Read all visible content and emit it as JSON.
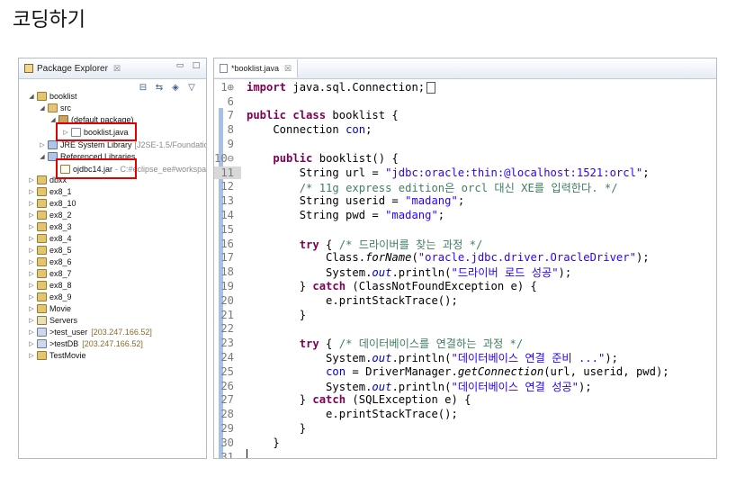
{
  "slide": {
    "title": "코딩하기"
  },
  "package_explorer": {
    "tab_label": "Package Explorer",
    "tab_close": "☒",
    "tree": [
      {
        "label": "booklist",
        "suffix": "",
        "icon": "project-icon",
        "twisty": "◢"
      },
      {
        "label": "src",
        "suffix": "",
        "icon": "source-folder-icon",
        "twisty": "◢"
      },
      {
        "label": "(default package)",
        "suffix": "",
        "icon": "package-icon",
        "twisty": "◢"
      },
      {
        "label": "booklist.java",
        "suffix": "",
        "icon": "java-file-icon",
        "twisty": "▷"
      },
      {
        "label": "JRE System Library",
        "suffix": "[J2SE-1.5/Foundation",
        "icon": "library-icon",
        "twisty": "▷"
      },
      {
        "label": "Referenced Libraries",
        "suffix": "",
        "icon": "library-icon",
        "twisty": "◢"
      },
      {
        "label": "ojdbc14.jar",
        "suffix": "- C:#eclipse_ee#workspa",
        "icon": "jar-icon",
        "twisty": ""
      },
      {
        "label": "dbxx",
        "suffix": "",
        "icon": "project-icon",
        "twisty": "▷"
      },
      {
        "label": "ex8_1",
        "suffix": "",
        "icon": "project-icon",
        "twisty": "▷"
      },
      {
        "label": "ex8_10",
        "suffix": "",
        "icon": "project-icon",
        "twisty": "▷"
      },
      {
        "label": "ex8_2",
        "suffix": "",
        "icon": "project-icon",
        "twisty": "▷"
      },
      {
        "label": "ex8_3",
        "suffix": "",
        "icon": "project-icon",
        "twisty": "▷"
      },
      {
        "label": "ex8_4",
        "suffix": "",
        "icon": "project-icon",
        "twisty": "▷"
      },
      {
        "label": "ex8_5",
        "suffix": "",
        "icon": "project-icon",
        "twisty": "▷"
      },
      {
        "label": "ex8_6",
        "suffix": "",
        "icon": "project-icon",
        "twisty": "▷"
      },
      {
        "label": "ex8_7",
        "suffix": "",
        "icon": "project-icon",
        "twisty": "▷"
      },
      {
        "label": "ex8_8",
        "suffix": "",
        "icon": "project-icon",
        "twisty": "▷"
      },
      {
        "label": "ex8_9",
        "suffix": "",
        "icon": "project-icon",
        "twisty": "▷"
      },
      {
        "label": "Movie",
        "suffix": "",
        "icon": "project-icon",
        "twisty": "▷"
      },
      {
        "label": "Servers",
        "suffix": "",
        "icon": "server-icon",
        "twisty": "▷"
      },
      {
        "label": ">test_user",
        "suffix": "[203.247.166.52]",
        "icon": "database-icon",
        "twisty": "▷"
      },
      {
        "label": ">testDB",
        "suffix": "[203.247.166.52]",
        "icon": "database-icon",
        "twisty": "▷"
      },
      {
        "label": "TestMovie",
        "suffix": "",
        "icon": "project-icon",
        "twisty": "▷"
      }
    ]
  },
  "editor": {
    "tab_label": "*booklist.java",
    "tab_close": "☒",
    "current_line": "11",
    "lines": [
      {
        "n": "1⊕",
        "tokens": [
          [
            "kw",
            "import"
          ],
          [
            "plain",
            " java.sql.Connection;"
          ]
        ],
        "box": true
      },
      {
        "n": "6",
        "tokens": []
      },
      {
        "n": "7",
        "tokens": [
          [
            "kw",
            "public"
          ],
          [
            "plain",
            " "
          ],
          [
            "kw",
            "class"
          ],
          [
            "plain",
            " booklist {"
          ]
        ]
      },
      {
        "n": "8",
        "tokens": [
          [
            "plain",
            "    Connection "
          ],
          [
            "fld2",
            "con"
          ],
          [
            "plain",
            ";"
          ]
        ]
      },
      {
        "n": "9",
        "tokens": []
      },
      {
        "n": "10⊖",
        "tokens": [
          [
            "plain",
            "    "
          ],
          [
            "kw",
            "public"
          ],
          [
            "plain",
            " booklist() {"
          ]
        ]
      },
      {
        "n": "11",
        "tokens": [
          [
            "plain",
            "        String url = "
          ],
          [
            "str",
            "\"jdbc:oracle:thin:@localhost:1521:orcl\""
          ],
          [
            "plain",
            ";"
          ]
        ]
      },
      {
        "n": "12",
        "tokens": [
          [
            "plain",
            "        "
          ],
          [
            "cm",
            "/* 11g express edition은 orcl 대신 XE를 입력한다. */"
          ]
        ]
      },
      {
        "n": "13",
        "tokens": [
          [
            "plain",
            "        String userid = "
          ],
          [
            "str",
            "\"madang\""
          ],
          [
            "plain",
            ";"
          ]
        ]
      },
      {
        "n": "14",
        "tokens": [
          [
            "plain",
            "        String pwd = "
          ],
          [
            "str",
            "\"madang\""
          ],
          [
            "plain",
            ";"
          ]
        ]
      },
      {
        "n": "15",
        "tokens": []
      },
      {
        "n": "16",
        "tokens": [
          [
            "plain",
            "        "
          ],
          [
            "kw",
            "try"
          ],
          [
            "plain",
            " { "
          ],
          [
            "cm",
            "/* 드라이버를 찾는 과정 */"
          ]
        ]
      },
      {
        "n": "17",
        "tokens": [
          [
            "plain",
            "            Class."
          ],
          [
            "mth",
            "forName"
          ],
          [
            "plain",
            "("
          ],
          [
            "str",
            "\"oracle.jdbc.driver.OracleDriver\""
          ],
          [
            "plain",
            ");"
          ]
        ]
      },
      {
        "n": "18",
        "tokens": [
          [
            "plain",
            "            System."
          ],
          [
            "fld",
            "out"
          ],
          [
            "plain",
            ".println("
          ],
          [
            "str",
            "\"드라이버 로드 성공\""
          ],
          [
            "plain",
            ");"
          ]
        ]
      },
      {
        "n": "19",
        "tokens": [
          [
            "plain",
            "        } "
          ],
          [
            "kw",
            "catch"
          ],
          [
            "plain",
            " (ClassNotFoundException e) {"
          ]
        ]
      },
      {
        "n": "20",
        "tokens": [
          [
            "plain",
            "            e.printStackTrace();"
          ]
        ]
      },
      {
        "n": "21",
        "tokens": [
          [
            "plain",
            "        }"
          ]
        ]
      },
      {
        "n": "22",
        "tokens": []
      },
      {
        "n": "23",
        "tokens": [
          [
            "plain",
            "        "
          ],
          [
            "kw",
            "try"
          ],
          [
            "plain",
            " { "
          ],
          [
            "cm",
            "/* 데이터베이스를 연결하는 과정 */"
          ]
        ]
      },
      {
        "n": "24",
        "tokens": [
          [
            "plain",
            "            System."
          ],
          [
            "fld",
            "out"
          ],
          [
            "plain",
            ".println("
          ],
          [
            "str",
            "\"데이터베이스 연결 준비 ...\""
          ],
          [
            "plain",
            ");"
          ]
        ]
      },
      {
        "n": "25",
        "tokens": [
          [
            "plain",
            "            "
          ],
          [
            "fld2",
            "con"
          ],
          [
            "plain",
            " = DriverManager."
          ],
          [
            "mth",
            "getConnection"
          ],
          [
            "plain",
            "(url, userid, pwd);"
          ]
        ]
      },
      {
        "n": "26",
        "tokens": [
          [
            "plain",
            "            System."
          ],
          [
            "fld",
            "out"
          ],
          [
            "plain",
            ".println("
          ],
          [
            "str",
            "\"데이터베이스 연결 성공\""
          ],
          [
            "plain",
            ");"
          ]
        ]
      },
      {
        "n": "27",
        "tokens": [
          [
            "plain",
            "        } "
          ],
          [
            "kw",
            "catch"
          ],
          [
            "plain",
            " (SQLException e) {"
          ]
        ]
      },
      {
        "n": "28",
        "tokens": [
          [
            "plain",
            "            e.printStackTrace();"
          ]
        ]
      },
      {
        "n": "29",
        "tokens": [
          [
            "plain",
            "        }"
          ]
        ]
      },
      {
        "n": "30",
        "tokens": [
          [
            "plain",
            "    }"
          ]
        ]
      },
      {
        "n": "31",
        "tokens": [],
        "caret": true
      }
    ]
  },
  "colors": {
    "keyword": "#7f0055",
    "string": "#2a00ff",
    "comment": "#3f7f5f",
    "field": "#0000c0",
    "highlight_box": "#e20000"
  }
}
